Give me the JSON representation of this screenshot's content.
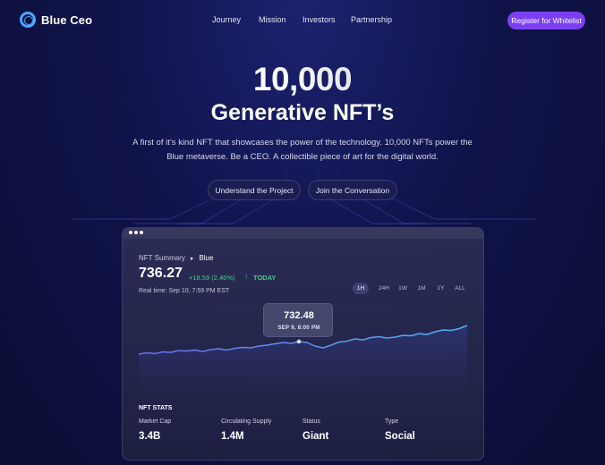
{
  "brand": {
    "name": "Blue Ceo"
  },
  "nav": {
    "links": [
      "Journey",
      "Mission",
      "Investors",
      "Partnership"
    ],
    "cta": "Register for Whitelist"
  },
  "hero": {
    "number": "10,000",
    "title": "Generative NFT’s",
    "description": "A first of it’s kind NFT that showcases the power of the technology. 10,000 NFTs power the Blue metaverse. Be a CEO.  A collectible piece of art for the digital world.",
    "buttons": [
      "Understand the Project",
      "Join the Conversation"
    ]
  },
  "card": {
    "breadcrumb": [
      "NFT Summary",
      "Blue"
    ],
    "price": "736.27",
    "change": "+18.59 (2.46%)",
    "change_period": "TODAY",
    "realtime": "Real time: Sep 10, 7:59 PM EST",
    "ranges": [
      "1H",
      "24H",
      "1W",
      "1M",
      "1Y",
      "ALL"
    ],
    "active_range": "1H",
    "tooltip": {
      "value": "732.48",
      "date": "SEP 9,  8:00 PM"
    },
    "stats_title": "NFT STATS",
    "stats": [
      {
        "label": "Market Cap",
        "value": "3.4B"
      },
      {
        "label": "Circulating Supply",
        "value": "1.4M"
      },
      {
        "label": "Status",
        "value": "Giant"
      },
      {
        "label": "Type",
        "value": "Social"
      }
    ]
  },
  "colors": {
    "accent": "#7b3ff2",
    "logo": "#4aa8ff",
    "positive": "#3fd07a",
    "line_start": "#6f6cf0",
    "line_end": "#49b7f2"
  },
  "chart_data": {
    "type": "line",
    "series": [
      {
        "values": [
          0.18,
          0.21,
          0.19,
          0.23,
          0.22,
          0.26,
          0.25,
          0.27,
          0.24,
          0.28,
          0.3,
          0.27,
          0.31,
          0.33,
          0.32,
          0.36,
          0.38,
          0.41,
          0.44,
          0.42,
          0.46,
          0.44,
          0.36,
          0.32,
          0.38,
          0.45,
          0.47,
          0.52,
          0.5,
          0.55,
          0.57,
          0.54,
          0.56,
          0.6,
          0.59,
          0.64,
          0.62,
          0.68,
          0.72,
          0.71,
          0.75,
          0.82
        ]
      }
    ],
    "highlight_index": 20
  }
}
